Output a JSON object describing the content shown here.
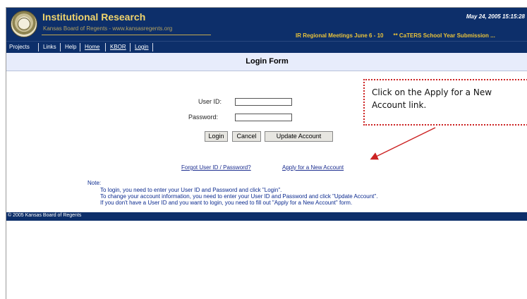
{
  "header": {
    "title": "Institutional Research",
    "subtitle": "Kansas Board of Regents - www.kansasregents.org",
    "date": "May 24, 2005 15:15:28",
    "ticker": [
      "IR Regional Meetings June 6 - 10",
      "** CaTERS School Year Submission ..."
    ]
  },
  "nav": {
    "items": [
      {
        "label": "Projects"
      },
      {
        "label": "Links"
      },
      {
        "label": "Help"
      },
      {
        "label": "Home"
      },
      {
        "label": "KBOR"
      },
      {
        "label": "Login"
      }
    ]
  },
  "page": {
    "title": "Login Form"
  },
  "form": {
    "user_id_label": "User ID:",
    "password_label": "Password:",
    "user_id_value": "",
    "password_value": "",
    "login_button": "Login",
    "cancel_button": "Cancel",
    "update_button": "Update Account"
  },
  "links": {
    "forgot": "Forgot User ID / Password?",
    "apply": "Apply for a New Account"
  },
  "note": {
    "heading": "Note:",
    "lines": [
      "To login, you need to enter your User ID and Password and click \"Login\".",
      "To change your account information, you need to enter your User ID and Password and click \"Update Account\".",
      "If you don't have a User ID and you want to login, you need to fill out \"Apply for a New Account\" form."
    ]
  },
  "footer": {
    "text": "© 2005 Kansas Board of Regents"
  },
  "callout": {
    "text": "Click on the Apply for a New Account link.",
    "color": "#cc2222"
  },
  "colors": {
    "header_bg": "#0d2f6a",
    "title_gold": "#f0d46c",
    "title_bar": "#e7ecfb",
    "link": "#1b2d8f"
  }
}
